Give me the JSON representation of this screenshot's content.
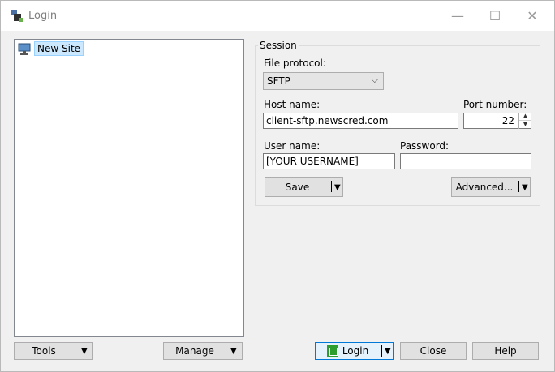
{
  "window": {
    "title": "Login"
  },
  "tree": {
    "items": [
      {
        "label": "New Site"
      }
    ]
  },
  "session": {
    "group_title": "Session",
    "file_protocol_label": "File protocol:",
    "file_protocol_value": "SFTP",
    "host_name_label": "Host name:",
    "host_name_value": "client-sftp.newscred.com",
    "port_number_label": "Port number:",
    "port_number_value": "22",
    "user_name_label": "User name:",
    "user_name_value": "[YOUR USERNAME]",
    "password_label": "Password:",
    "password_value": "",
    "save_label": "Save",
    "advanced_label": "Advanced..."
  },
  "bottom": {
    "tools_label": "Tools",
    "manage_label": "Manage",
    "login_label": "Login",
    "close_label": "Close",
    "help_label": "Help"
  }
}
